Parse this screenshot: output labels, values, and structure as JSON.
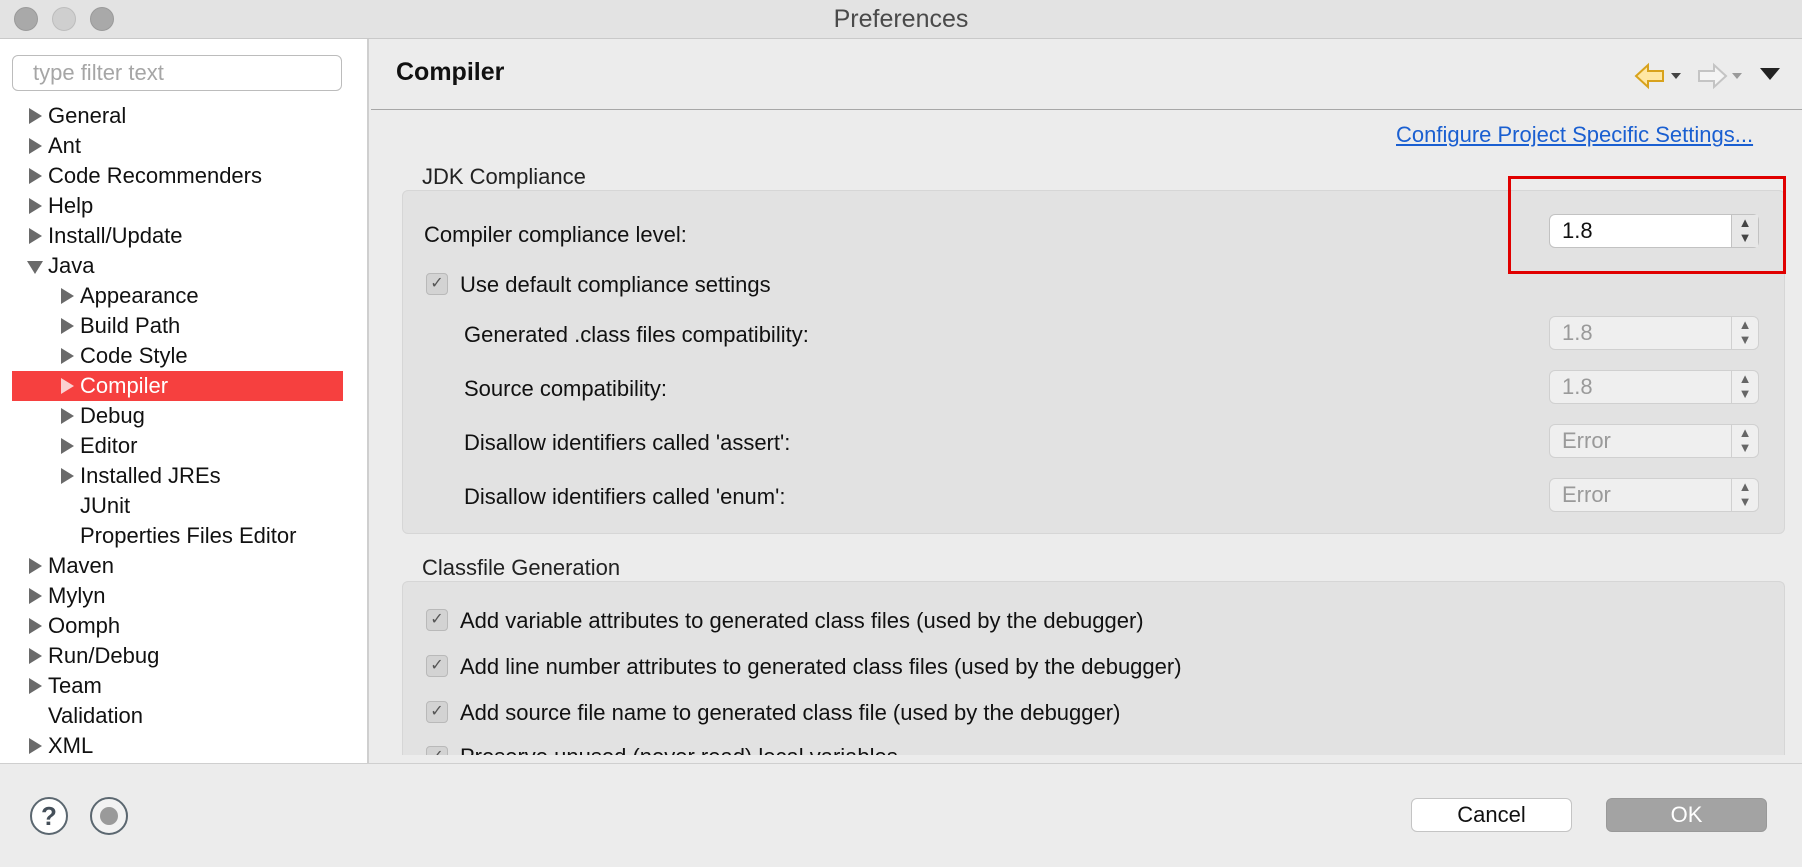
{
  "window": {
    "title": "Preferences"
  },
  "filter": {
    "placeholder": "type filter text",
    "value": ""
  },
  "tree": [
    {
      "label": "General",
      "expander": "right"
    },
    {
      "label": "Ant",
      "expander": "right"
    },
    {
      "label": "Code Recommenders",
      "expander": "right"
    },
    {
      "label": "Help",
      "expander": "right"
    },
    {
      "label": "Install/Update",
      "expander": "right"
    },
    {
      "label": "Java",
      "expander": "down"
    },
    {
      "label": "Appearance",
      "expander": "right"
    },
    {
      "label": "Build Path",
      "expander": "right"
    },
    {
      "label": "Code Style",
      "expander": "right"
    },
    {
      "label": "Compiler",
      "expander": "right",
      "selected": true
    },
    {
      "label": "Debug",
      "expander": "right"
    },
    {
      "label": "Editor",
      "expander": "right"
    },
    {
      "label": "Installed JREs",
      "expander": "right"
    },
    {
      "label": "JUnit",
      "expander": "none"
    },
    {
      "label": "Properties Files Editor",
      "expander": "none"
    },
    {
      "label": "Maven",
      "expander": "right"
    },
    {
      "label": "Mylyn",
      "expander": "right"
    },
    {
      "label": "Oomph",
      "expander": "right"
    },
    {
      "label": "Run/Debug",
      "expander": "right"
    },
    {
      "label": "Team",
      "expander": "right"
    },
    {
      "label": "Validation",
      "expander": "none"
    },
    {
      "label": "XML",
      "expander": "right"
    }
  ],
  "page": {
    "title": "Compiler",
    "link": "Configure Project Specific Settings...",
    "icons": [
      "back-arrow-icon",
      "forward-arrow-icon",
      "view-menu-icon"
    ]
  },
  "jdk": {
    "group_title": "JDK Compliance",
    "compliance_label": "Compiler compliance level:",
    "compliance_value": "1.8",
    "use_default_label": "Use default compliance settings",
    "use_default_checked": true,
    "rows": [
      {
        "label": "Generated .class files compatibility:",
        "value": "1.8"
      },
      {
        "label": "Source compatibility:",
        "value": "1.8"
      },
      {
        "label": "Disallow identifiers called 'assert':",
        "value": "Error"
      },
      {
        "label": "Disallow identifiers called 'enum':",
        "value": "Error"
      }
    ]
  },
  "classfile": {
    "group_title": "Classfile Generation",
    "options": [
      {
        "label": "Add variable attributes to generated class files (used by the debugger)",
        "checked": true
      },
      {
        "label": "Add line number attributes to generated class files (used by the debugger)",
        "checked": true
      },
      {
        "label": "Add source file name to generated class file (used by the debugger)",
        "checked": true
      },
      {
        "label": "Preserve unused (never read) local variables",
        "checked": true
      }
    ]
  },
  "footer": {
    "help_icon": "question-mark-icon",
    "import_export_icon": "record-icon",
    "cancel": "Cancel",
    "ok": "OK"
  },
  "colors": {
    "selection": "#f6403f",
    "link": "#1a5fd1",
    "highlight": "#e00000"
  }
}
